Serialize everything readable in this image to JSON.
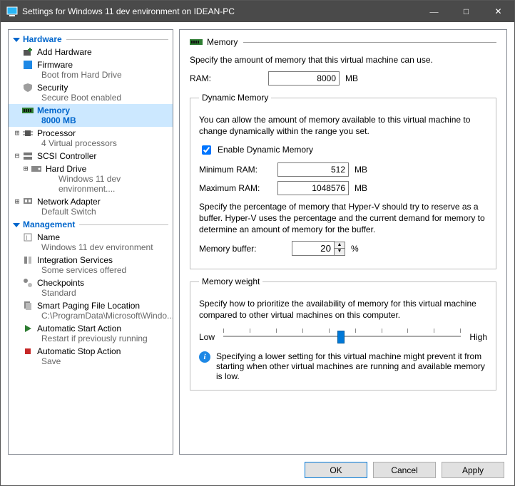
{
  "window": {
    "title": "Settings for Windows 11 dev environment on IDEAN-PC"
  },
  "sections": {
    "hardware": "Hardware",
    "management": "Management"
  },
  "tree": {
    "add_hardware": "Add Hardware",
    "firmware": {
      "label": "Firmware",
      "sub": "Boot from Hard Drive"
    },
    "security": {
      "label": "Security",
      "sub": "Secure Boot enabled"
    },
    "memory": {
      "label": "Memory",
      "sub": "8000 MB"
    },
    "processor": {
      "label": "Processor",
      "sub": "4 Virtual processors"
    },
    "scsi": {
      "label": "SCSI Controller"
    },
    "hard_drive": {
      "label": "Hard Drive",
      "sub": "Windows 11 dev environment...."
    },
    "net": {
      "label": "Network Adapter",
      "sub": "Default Switch"
    },
    "name": {
      "label": "Name",
      "sub": "Windows 11 dev environment"
    },
    "integ": {
      "label": "Integration Services",
      "sub": "Some services offered"
    },
    "check": {
      "label": "Checkpoints",
      "sub": "Standard"
    },
    "paging": {
      "label": "Smart Paging File Location",
      "sub": "C:\\ProgramData\\Microsoft\\Windo..."
    },
    "autostart": {
      "label": "Automatic Start Action",
      "sub": "Restart if previously running"
    },
    "autostop": {
      "label": "Automatic Stop Action",
      "sub": "Save"
    }
  },
  "panel": {
    "heading": "Memory",
    "intro": "Specify the amount of memory that this virtual machine can use.",
    "ram_label": "RAM:",
    "ram_value": "8000",
    "mb": "MB",
    "dyn": {
      "legend": "Dynamic Memory",
      "desc": "You can allow the amount of memory available to this virtual machine to change dynamically within the range you set.",
      "enable": "Enable Dynamic Memory",
      "min_label": "Minimum RAM:",
      "min_value": "512",
      "max_label": "Maximum RAM:",
      "max_value": "1048576",
      "buffer_desc": "Specify the percentage of memory that Hyper-V should try to reserve as a buffer. Hyper-V uses the percentage and the current demand for memory to determine an amount of memory for the buffer.",
      "buffer_label": "Memory buffer:",
      "buffer_value": "20",
      "pct": "%"
    },
    "weight": {
      "legend": "Memory weight",
      "desc": "Specify how to prioritize the availability of memory for this virtual machine compared to other virtual machines on this computer.",
      "low": "Low",
      "high": "High",
      "info": "Specifying a lower setting for this virtual machine might prevent it from starting when other virtual machines are running and available memory is low."
    }
  },
  "buttons": {
    "ok": "OK",
    "cancel": "Cancel",
    "apply": "Apply"
  }
}
